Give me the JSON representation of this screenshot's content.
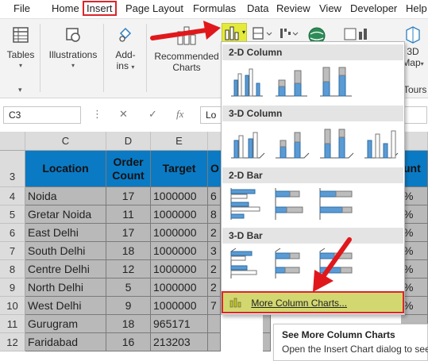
{
  "menu": {
    "tabs": [
      {
        "label": "File"
      },
      {
        "label": "Home"
      },
      {
        "label": "Insert"
      },
      {
        "label": "Page Layout"
      },
      {
        "label": "Formulas"
      },
      {
        "label": "Data"
      },
      {
        "label": "Review"
      },
      {
        "label": "View"
      },
      {
        "label": "Developer"
      },
      {
        "label": "Help"
      }
    ],
    "active_tab": "Insert"
  },
  "ribbon": {
    "tables_label": "Tables",
    "illustrations_label": "Illustrations",
    "addins_label_line1": "Add-",
    "addins_label_line2": "ins",
    "recommended_line1": "Recommended",
    "recommended_line2": "Charts",
    "map_line1": "3D",
    "map_line2": "Map",
    "tours_label": "Tours"
  },
  "formula_bar": {
    "name_box": "C3",
    "cancel_symbol": "✕",
    "enter_symbol": "✓",
    "fx_symbol": "fx",
    "content": "Lo"
  },
  "grid": {
    "column_headers": [
      "C",
      "D",
      "E"
    ],
    "row_numbers": [
      "3",
      "4",
      "5",
      "6",
      "7",
      "8",
      "9",
      "10",
      "11",
      "12"
    ],
    "headers": {
      "location": "Location",
      "order_count": "Order Count",
      "target": "Target",
      "partial_col_f": "O",
      "partial_col_i": "unt"
    },
    "rows": [
      {
        "location": "Noida",
        "order_count": "17",
        "target": "1000000",
        "col_f": "6",
        "col_i": "%"
      },
      {
        "location": "Gretar Noida",
        "order_count": "11",
        "target": "1000000",
        "col_f": "8",
        "col_i": "%"
      },
      {
        "location": "East Delhi",
        "order_count": "17",
        "target": "1000000",
        "col_f": "2",
        "col_i": "%"
      },
      {
        "location": "South Delhi",
        "order_count": "18",
        "target": "1000000",
        "col_f": "3",
        "col_i": "%"
      },
      {
        "location": "Centre Delhi",
        "order_count": "12",
        "target": "1000000",
        "col_f": "2",
        "col_i": "%"
      },
      {
        "location": "North Delhi",
        "order_count": "5",
        "target": "1000000",
        "col_f": "2",
        "col_i": "%"
      },
      {
        "location": "West Delhi",
        "order_count": "9",
        "target": "1000000",
        "col_f": "7",
        "col_i": "%"
      },
      {
        "location": "Gurugram",
        "order_count": "18",
        "target": "965171",
        "col_f": "",
        "col_i": ""
      },
      {
        "location": "Faridabad",
        "order_count": "16",
        "target": "213203",
        "col_f": "",
        "col_i": ""
      }
    ]
  },
  "dropdown": {
    "sections": [
      "2-D Column",
      "3-D Column",
      "2-D Bar",
      "3-D Bar"
    ],
    "more_label": "More Column Charts..."
  },
  "tooltip": {
    "title": "See More Column Charts",
    "body": "Open the Insert Chart dialog to see"
  },
  "colors": {
    "accent_red": "#d9262c",
    "header_blue": "#0a7ac4",
    "highlight_yellow": "#d2d86f"
  }
}
